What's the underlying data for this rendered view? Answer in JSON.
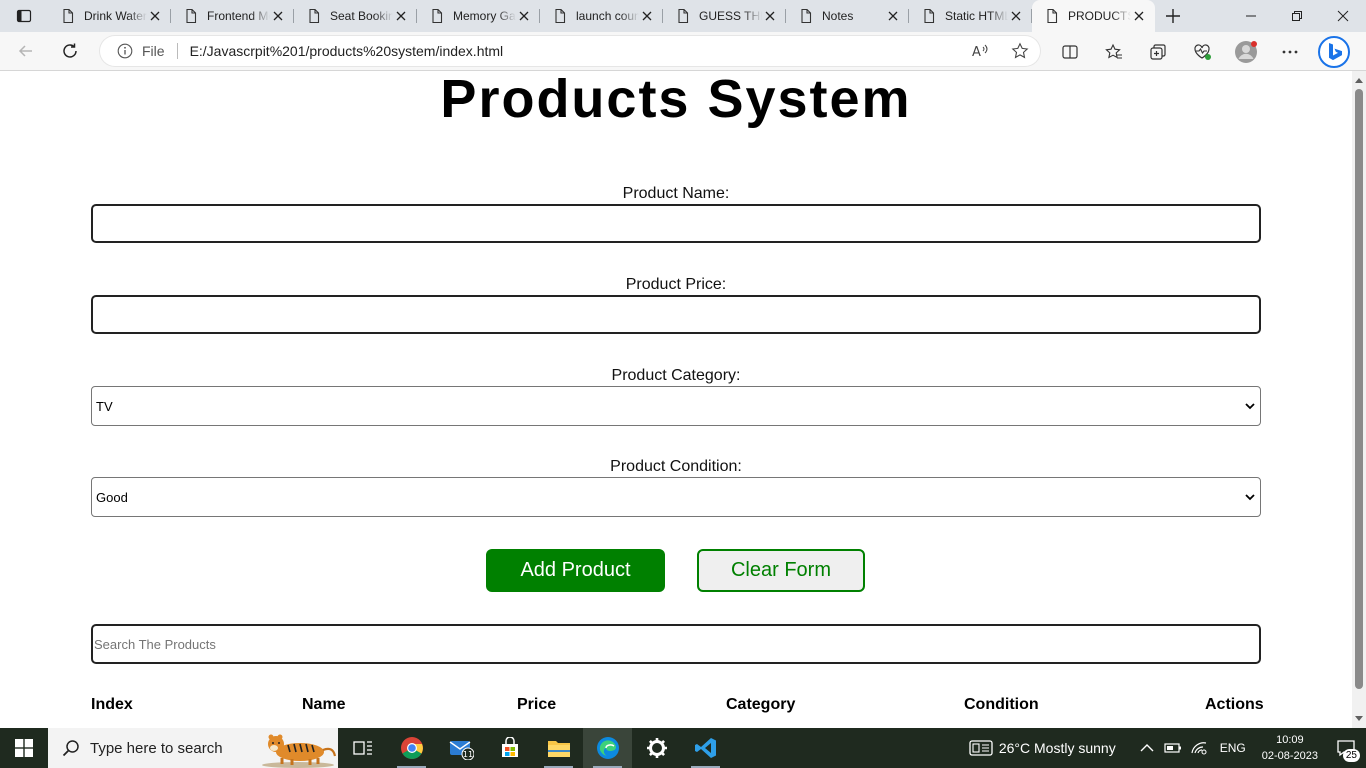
{
  "browser": {
    "tabs": [
      {
        "title": "Drink Water"
      },
      {
        "title": "Frontend Mentor"
      },
      {
        "title": "Seat Booking"
      },
      {
        "title": "Memory Game"
      },
      {
        "title": "launch countdown"
      },
      {
        "title": "GUESS THE NUMBER"
      },
      {
        "title": "Notes"
      },
      {
        "title": "Static HTML"
      },
      {
        "title": "PRODUCTS"
      }
    ],
    "active_tab": 8,
    "address": {
      "scheme_label": "File",
      "url": "E:/Javascrpit%201/products%20system/index.html"
    }
  },
  "page": {
    "title": "Products System",
    "form": {
      "name_label": "Product Name:",
      "name_value": "",
      "price_label": "Product Price:",
      "price_value": "",
      "category_label": "Product Category:",
      "category_value": "TV",
      "condition_label": "Product Condition:",
      "condition_value": "Good",
      "add_button": "Add Product",
      "clear_button": "Clear Form"
    },
    "search": {
      "placeholder": "Search The Products"
    },
    "table": {
      "headers": [
        "Index",
        "Name",
        "Price",
        "Category",
        "Condition",
        "Actions"
      ]
    }
  },
  "taskbar": {
    "search_placeholder": "Type here to search",
    "mail_badge": "11",
    "weather": "26°C  Mostly sunny",
    "language": "ENG",
    "time": "10:09",
    "date": "02-08-2023",
    "notification_count": "25"
  },
  "colors": {
    "accent_green": "#008000",
    "edge_blue": "#0078d4"
  },
  "icons": [
    "tab-actions-icon",
    "page-icon",
    "close-icon",
    "plus-icon",
    "minimize-icon",
    "restore-icon",
    "back-icon",
    "refresh-icon",
    "info-icon",
    "read-aloud-icon",
    "star-icon",
    "split-screen-icon",
    "favorites-icon",
    "collections-icon",
    "performance-icon",
    "profile-icon",
    "more-icon",
    "bing-icon",
    "windows-icon",
    "search-icon",
    "task-view-icon",
    "chrome-icon",
    "mail-icon",
    "store-icon",
    "file-explorer-icon",
    "edge-icon",
    "settings-icon",
    "vscode-icon",
    "weather-icon",
    "chevron-up-icon",
    "battery-icon",
    "wifi-icon",
    "notification-icon"
  ]
}
